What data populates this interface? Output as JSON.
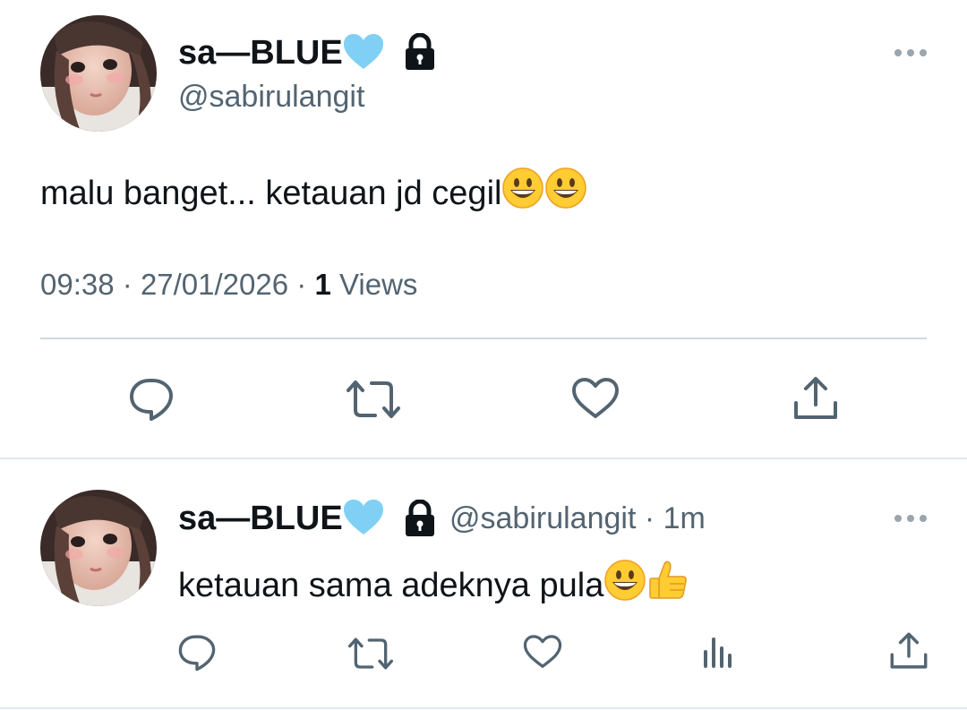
{
  "main_tweet": {
    "display_name": "sa—BLUE",
    "name_emoji": "light-blue-heart",
    "lock_icon": "lock-icon",
    "handle": "@sabirulangit",
    "text": "malu banget... ketauan jd cegil",
    "text_emojis": [
      "grinning-face",
      "grinning-face"
    ],
    "time": "09:38",
    "date": "27/01/2026",
    "views_count": "1",
    "views_label": "Views",
    "separator": "·"
  },
  "reply_tweet": {
    "display_name": "sa—BLUE",
    "handle": "@sabirulangit",
    "age": "1m",
    "separator": "·",
    "text": "ketauan sama adeknya pula",
    "text_emojis": [
      "grinning-face",
      "thumbs-up"
    ]
  },
  "colors": {
    "text_primary": "#0f1419",
    "text_secondary": "#536471",
    "divider": "#cfd9de",
    "heart_blue": "#7fd0f4",
    "emoji_yellow": "#ffcc33"
  }
}
